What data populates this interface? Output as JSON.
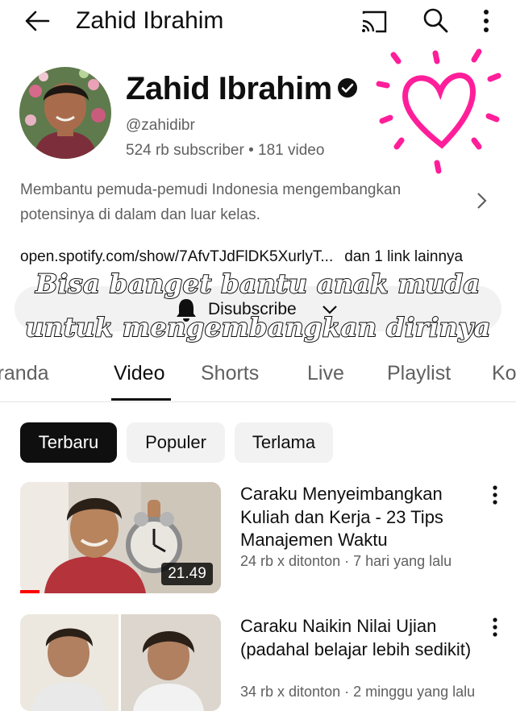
{
  "topbar": {
    "title": "Zahid Ibrahim"
  },
  "channel": {
    "name": "Zahid Ibrahim",
    "handle": "@zahidibr",
    "stats": "524 rb subscriber • 181 video",
    "description": "Membantu pemuda-pemudi Indonesia mengembangkan potensinya di dalam dan luar kelas.",
    "link": "open.spotify.com/show/7AfvTJdFlDK5XurlyT...",
    "more_links": "dan 1 link lainnya",
    "subscribe_label": "Disubscribe"
  },
  "caption": {
    "line1": "Bisa banget bantu anak muda",
    "line2": "untuk mengembangkan dirinya"
  },
  "tabs": [
    "Beranda",
    "Video",
    "Shorts",
    "Live",
    "Playlist",
    "Komunitas"
  ],
  "active_tab": "Video",
  "chips": [
    "Terbaru",
    "Populer",
    "Terlama"
  ],
  "selected_chip": "Terbaru",
  "videos": [
    {
      "title": "Caraku Menyeimbangkan Kuliah dan Kerja - 23 Tips Manajemen Waktu",
      "meta": "24 rb x ditonton · 7 hari yang lalu",
      "duration": "21.49"
    },
    {
      "title": "Caraku Naikin Nilai Ujian (padahal belajar lebih sedikit)",
      "meta": "34 rb x ditonton · 2 minggu yang lalu"
    }
  ],
  "colors": {
    "accent": "#ff0000",
    "sticker": "#ff1e9a",
    "text": "#0f0f0f",
    "secondary": "#606060"
  }
}
